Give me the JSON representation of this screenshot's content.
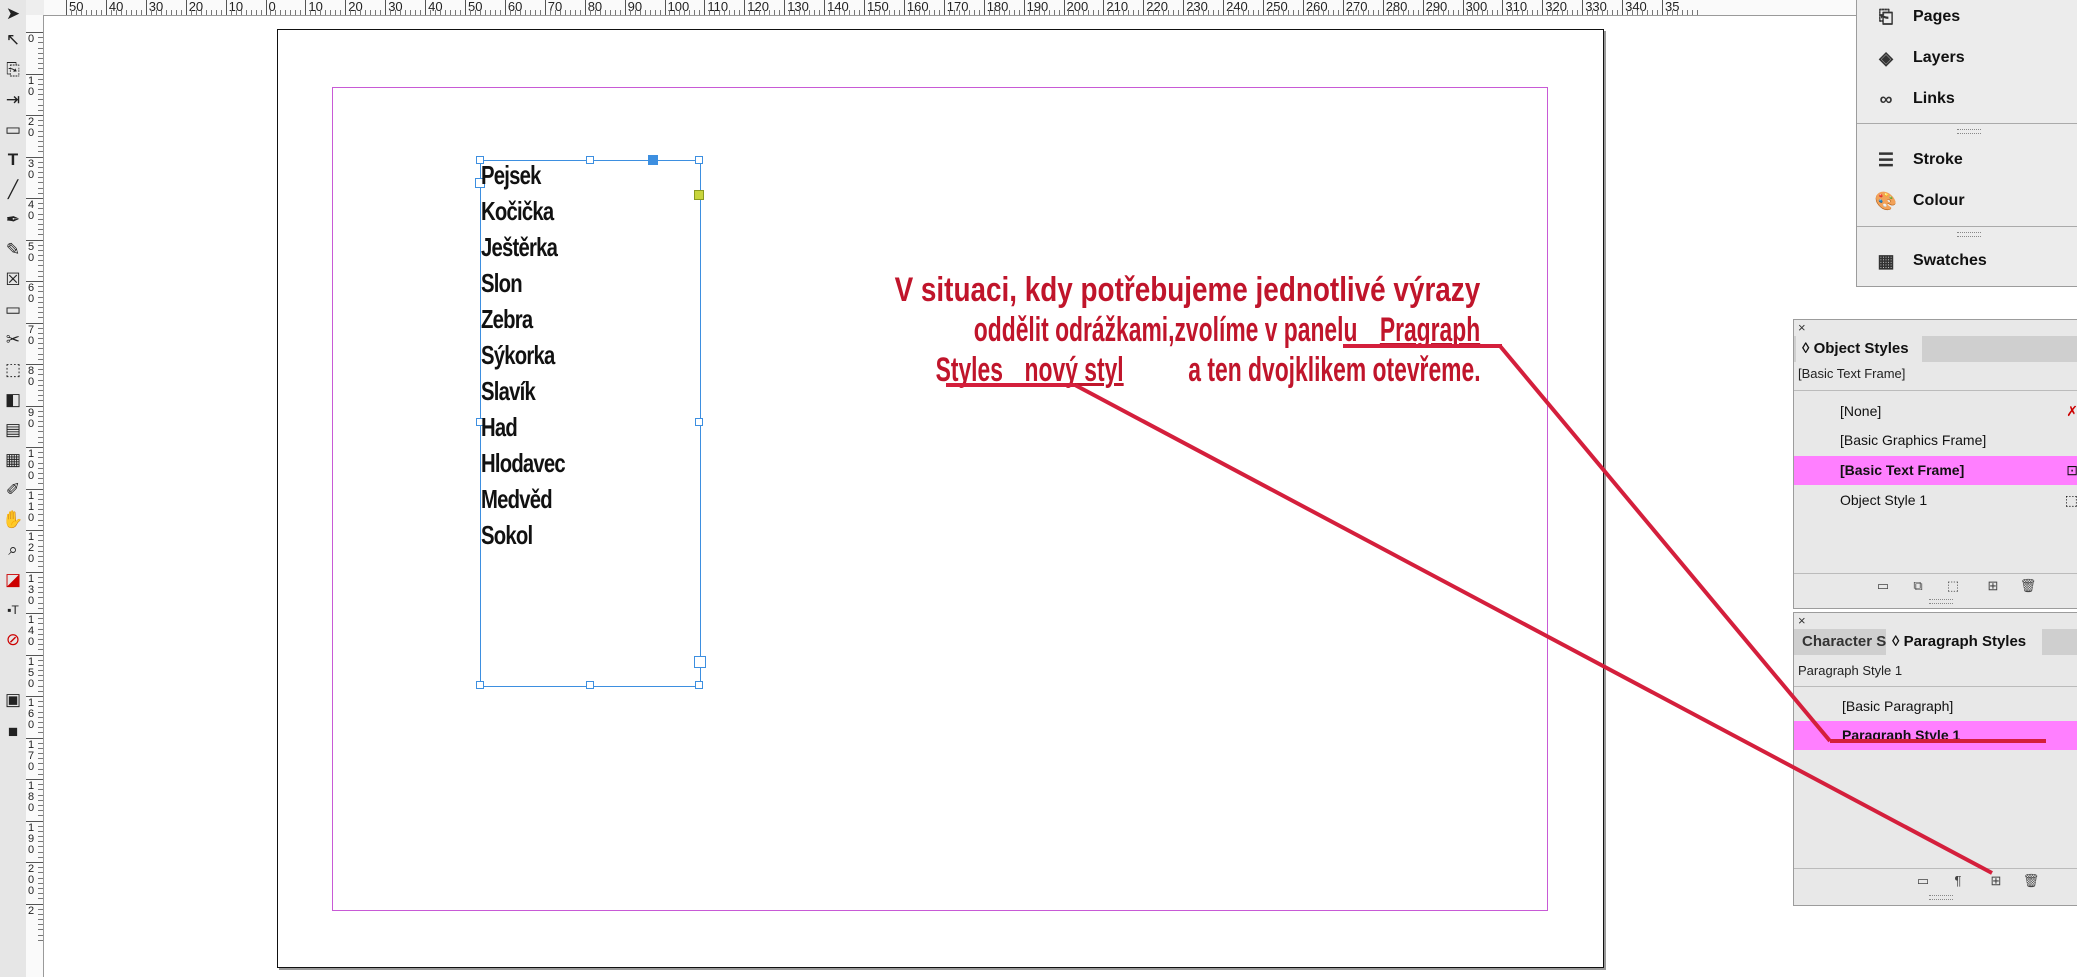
{
  "ruler": {
    "top_labels": [
      "50",
      "40",
      "30",
      "20",
      "10",
      "0",
      "10",
      "20",
      "30",
      "40",
      "50",
      "60",
      "70",
      "80",
      "90",
      "100",
      "110",
      "120",
      "130",
      "140",
      "150",
      "160",
      "170",
      "180",
      "190",
      "200",
      "210",
      "220",
      "230",
      "240",
      "250",
      "260",
      "270",
      "280",
      "290",
      "300",
      "310",
      "320",
      "330",
      "340",
      "35"
    ],
    "left_labels": [
      "0",
      "10",
      "20",
      "30",
      "40",
      "50",
      "60",
      "70",
      "80",
      "90",
      "100",
      "110",
      "120",
      "130",
      "140",
      "150",
      "160",
      "170",
      "180",
      "190",
      "200",
      "2"
    ]
  },
  "tools": [
    "selection-tool",
    "direct-selection-tool",
    "page-tool",
    "gap-tool",
    "content-collector-tool",
    "type-tool",
    "line-tool",
    "pen-tool",
    "pencil-tool",
    "rectangle-frame-tool",
    "rectangle-tool",
    "scissors-tool",
    "free-transform-tool",
    "gradient-swatch-tool",
    "gradient-feather-tool",
    "note-tool",
    "eyedropper-tool",
    "hand-tool",
    "zoom-tool",
    "fill-stroke",
    "formatting-container",
    "apply-none",
    "view-mode",
    "screen-mode"
  ],
  "document": {
    "list_items": [
      "Pejsek",
      "Kočička",
      "Ještěrka",
      "Slon",
      "Zebra",
      "Sýkorka",
      "Slavík",
      "Had",
      "Hlodavec",
      "Medvěd",
      "Sokol"
    ]
  },
  "annotation": {
    "line1": "V situaci, kdy potřebujeme jednotlivé výrazy",
    "line2_a": "oddělit odrážkami,zvolíme v panelu ",
    "line2_b": "Pragraph",
    "line3_a": "Styles ",
    "line3_b": "nový styl ",
    "line3_c": "a ten dvojklikem otevřeme.",
    "color": "#c0152b"
  },
  "dock": {
    "items": [
      {
        "label": "Pages",
        "icon": "pages-icon"
      },
      {
        "label": "Layers",
        "icon": "layers-icon"
      },
      {
        "label": "Links",
        "icon": "links-icon"
      },
      {
        "label": "Stroke",
        "icon": "stroke-icon"
      },
      {
        "label": "Colour",
        "icon": "colour-icon"
      },
      {
        "label": "Swatches",
        "icon": "swatches-icon"
      }
    ]
  },
  "object_styles": {
    "tab": "◊ Object Styles",
    "current": "[Basic Text Frame]",
    "rows": [
      "[None]",
      "[Basic Graphics Frame]",
      "[Basic Text Frame]",
      "Object Style 1"
    ],
    "selected_index": 2
  },
  "paragraph_styles": {
    "tab_character": "Character S",
    "tab_paragraph": "◊ Paragraph Styles",
    "current": "Paragraph Style 1",
    "rows": [
      "[Basic Paragraph]",
      "Paragraph Style 1"
    ],
    "selected_index": 1
  },
  "colors": {
    "selection": "#ff7fff",
    "frame": "#3d8fe0",
    "margin": "#c85ad6"
  }
}
